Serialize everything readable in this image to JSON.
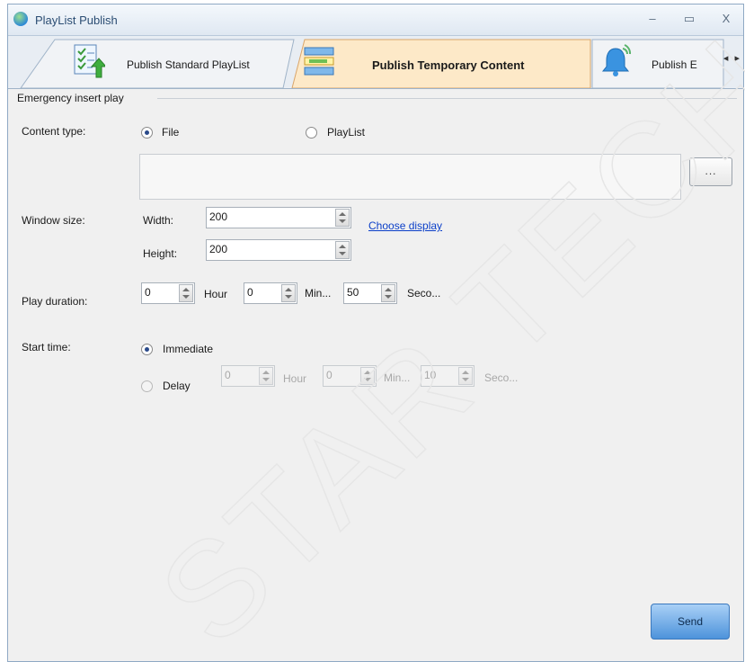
{
  "window": {
    "title": "PlayList Publish",
    "controls": {
      "minimize": "–",
      "maximize": "▭",
      "close": "X"
    }
  },
  "tabs": [
    {
      "label": "Publish Standard PlayList",
      "active": false,
      "icon": "checklist-upload-icon"
    },
    {
      "label": "Publish Temporary Content",
      "active": true,
      "icon": "temporary-content-icon"
    },
    {
      "label": "Publish E",
      "active": false,
      "icon": "bell-icon"
    }
  ],
  "tab_scroll": {
    "left": "◂",
    "right": "▸"
  },
  "section": {
    "title": "Emergency insert play"
  },
  "content_type": {
    "label": "Content type:",
    "options": [
      "File",
      "PlayList"
    ],
    "selected": "File",
    "file_path": "",
    "browse_label": "..."
  },
  "window_size": {
    "label": "Window size:",
    "width_label": "Width:",
    "width_value": "200",
    "height_label": "Height:",
    "height_value": "200",
    "choose_display_link": "Choose display"
  },
  "play_duration": {
    "label": "Play duration:",
    "hour_value": "0",
    "hour_unit": "Hour",
    "min_value": "0",
    "min_unit": "Min...",
    "sec_value": "50",
    "sec_unit": "Seco..."
  },
  "start_time": {
    "label": "Start time:",
    "immediate_label": "Immediate",
    "delay_label": "Delay",
    "selected": "Immediate",
    "delay_hour_value": "0",
    "delay_hour_unit": "Hour",
    "delay_min_value": "0",
    "delay_min_unit": "Min...",
    "delay_sec_value": "10",
    "delay_sec_unit": "Seco..."
  },
  "actions": {
    "send_label": "Send"
  },
  "watermark": {
    "text": "STAR TECH C"
  }
}
